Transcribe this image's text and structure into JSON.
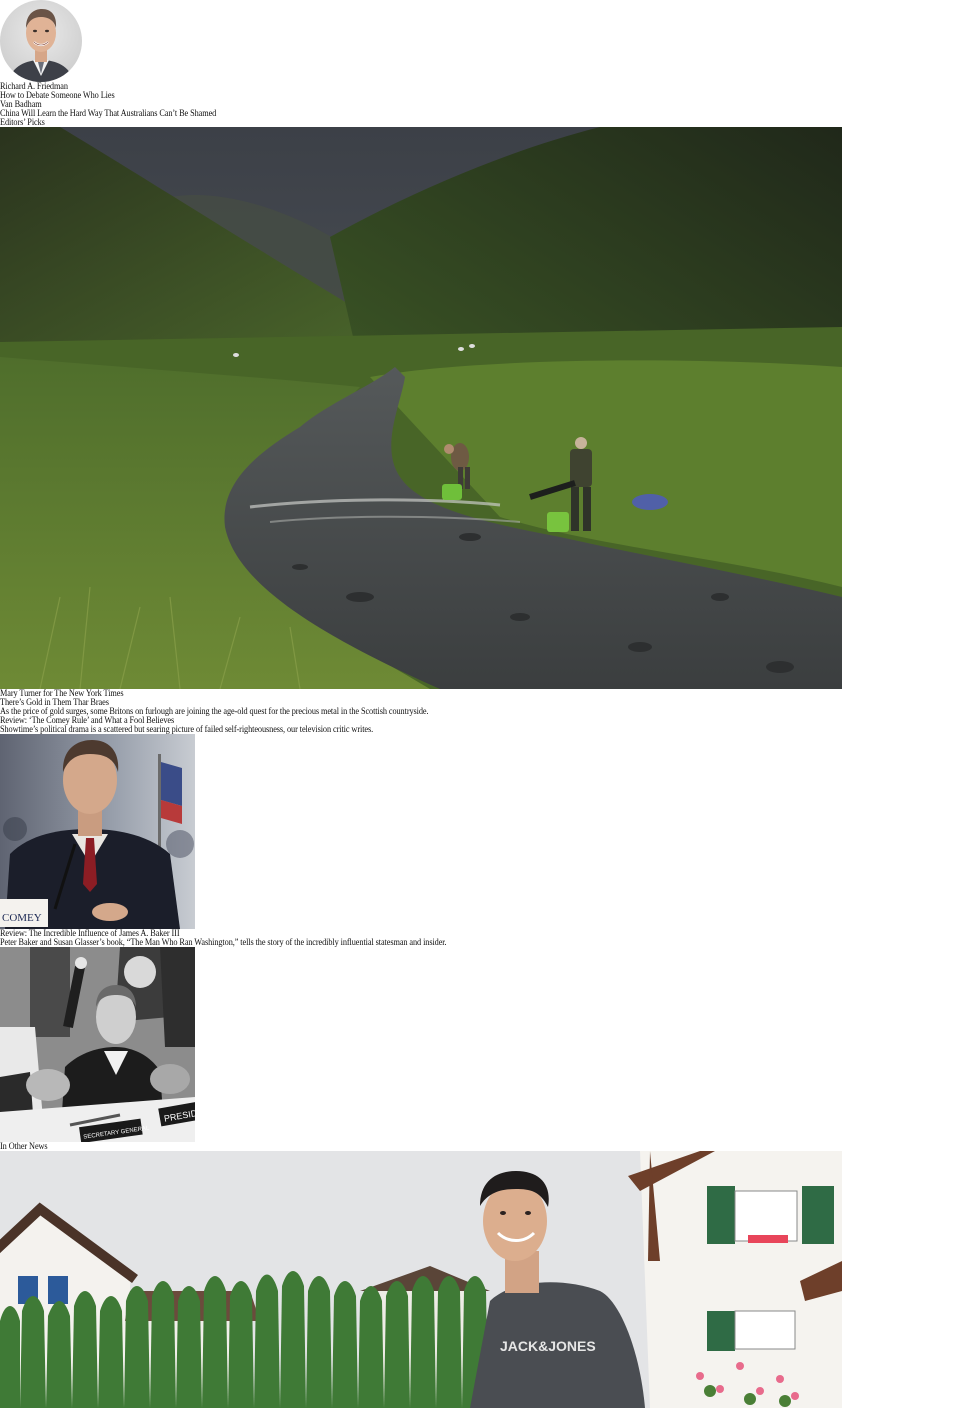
{
  "opinion": {
    "author_1": "Richard A. Friedman",
    "headline_1": "How to Debate Someone Who Lies",
    "author_2": "Van Badham",
    "headline_2": "China Will Learn the Hard Way That Australians Can’t Be Shamed"
  },
  "editors_picks": {
    "section_label": "Editors’ Picks",
    "feature": {
      "photo_credit": "Mary Turner for The New York Times",
      "headline": "There’s Gold in Them Thar Braes",
      "summary": "As the price of gold surges, some Britons on furlough are joining the age-old quest for the precious metal in the Scottish countryside."
    },
    "review_1": {
      "headline": "Review: ‘The Comey Rule’ and What a Fool Believes",
      "summary": "Showtime’s political drama is a scattered but searing picture of failed self-righteousness, our television critic writes.",
      "nameplate_text": "COMEY"
    },
    "review_2": {
      "headline": "Review: The Incredible Influence of James A. Baker III",
      "summary": "Peter Baker and Susan Glasser’s book, “The Man Who Ran Washington,” tells the story of the incredibly influential statesman and insider.",
      "placard_left": "SECRETARY GENERAL",
      "placard_right": "PRESID"
    }
  },
  "other_news": {
    "section_label": "In Other News",
    "shirt_text": "JACK&JONES"
  },
  "colors": {
    "text": "#111111",
    "background": "#ffffff"
  }
}
